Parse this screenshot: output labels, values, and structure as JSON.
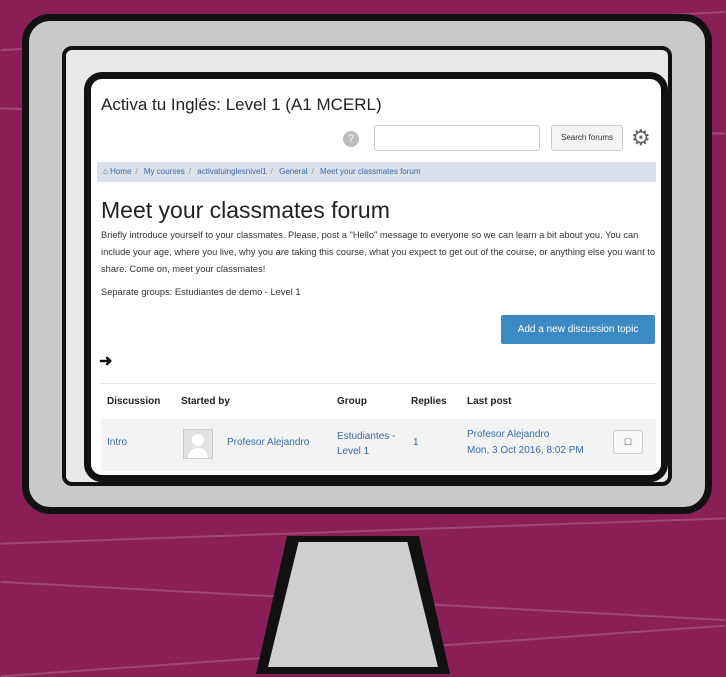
{
  "site": {
    "title": "Activa tu Inglés: Level 1 (A1 MCERL)"
  },
  "header": {
    "help_icon": "?",
    "search_placeholder": "",
    "search_button_label": "Search forums",
    "gear_icon": "gear-icon"
  },
  "breadcrumb": {
    "items": [
      "Home",
      "My courses",
      "activatuinglesnivel1",
      "General",
      "Meet your classmates forum"
    ]
  },
  "page": {
    "title": "Meet your classmates forum",
    "intro": "Briefly introduce yourself to your classmates. Please, post a \"Hello\" message to everyone so we can learn a bit about you. You can include your age, where you live, why you are taking this course, what you expect to get out of the course, or anything else you want to share. Come on, meet your classmates!",
    "groups_text": "Separate groups: Estudiantes de demo - Level 1",
    "add_topic_label": "Add a new discussion topic",
    "arrow_icon": "➜"
  },
  "table": {
    "headers": [
      "Discussion",
      "Started by",
      "Group",
      "Replies",
      "Last post"
    ],
    "rows": [
      {
        "discussion": "Intro",
        "started_by": "Profesor Alejandro",
        "group": "Estudiantes - Level 1",
        "replies": "1",
        "last_post_author": "Profesor Alejandro",
        "last_post_date": "Mon, 3 Oct 2016, 8:02 PM"
      }
    ]
  }
}
